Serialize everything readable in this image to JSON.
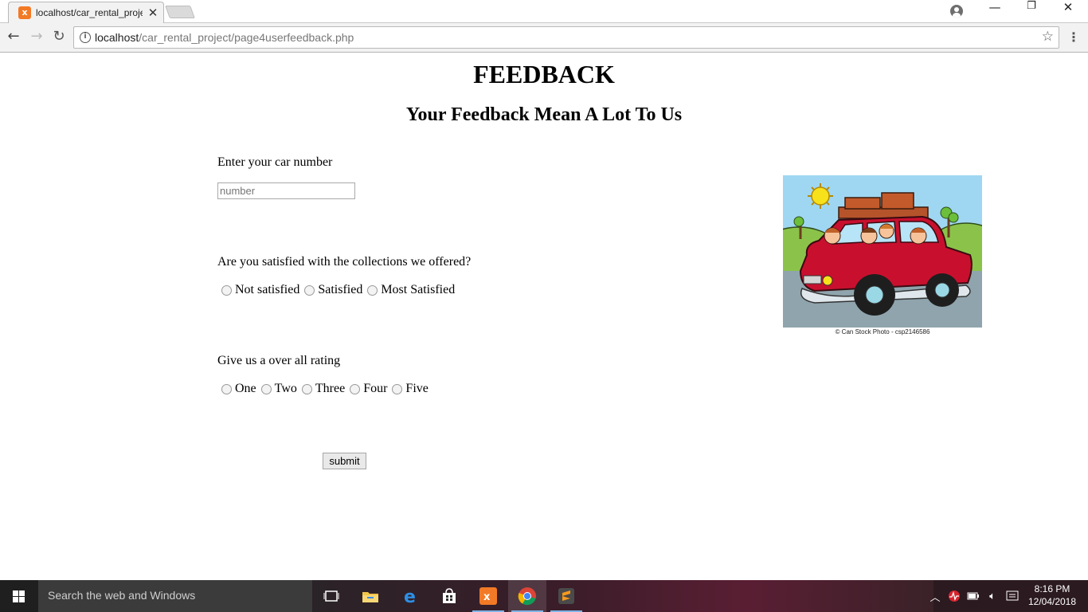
{
  "browser": {
    "tab_title": "localhost/car_rental_project/page4userfeedback.php",
    "tab_favicon_glyph": "x",
    "url_host": "localhost",
    "url_path": "/car_rental_project/page4userfeedback.php",
    "icons": [
      "back-arrow-icon",
      "forward-arrow-icon",
      "reload-icon",
      "info-icon",
      "star-icon",
      "menu-icon",
      "profile-icon",
      "minimize-icon",
      "restore-icon",
      "close-icon"
    ]
  },
  "page": {
    "heading": "FEEDBACK",
    "subheading": "Your Feedback Mean A Lot To Us",
    "car_number": {
      "label": "Enter your car number",
      "placeholder": "number",
      "value": ""
    },
    "satisfaction": {
      "question": "Are you satisfied with the collections we offered?",
      "options": [
        "Not satisfied",
        "Satisfied",
        "Most Satisfied"
      ],
      "selected": null
    },
    "rating": {
      "question": "Give us a over all rating",
      "options": [
        "One",
        "Two",
        "Three",
        "Four",
        "Five"
      ],
      "selected": null
    },
    "submit_label": "submit",
    "image_caption": "© Can Stock Photo - csp2146586"
  },
  "taskbar": {
    "search_placeholder": "Search the web and Windows",
    "apps": [
      "task-view-icon",
      "file-explorer-icon",
      "edge-icon",
      "store-icon",
      "xampp-icon",
      "chrome-icon",
      "sublime-text-icon"
    ],
    "active_app": "chrome-icon",
    "time": "8:16 PM",
    "date": "12/04/2018"
  }
}
